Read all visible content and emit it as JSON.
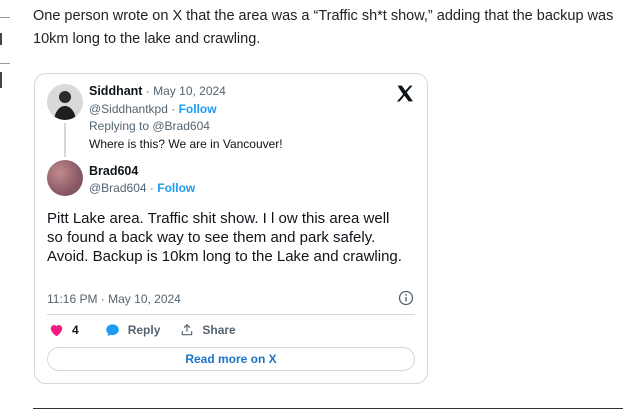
{
  "article": {
    "intro": "One person wrote on X that the area was a “Traffic sh*t show,” adding that the backup was 10km long to the lake and crawling."
  },
  "tweet": {
    "parent": {
      "name": "Siddhant",
      "date": "May 10, 2024",
      "handle": "@Siddhantkpd",
      "follow_label": "Follow",
      "replying_to": "Replying to @Brad604",
      "text": "Where is this? We are in Vancouver!"
    },
    "main": {
      "name": "Brad604",
      "handle": "@Brad604",
      "follow_label": "Follow",
      "text": "Pitt Lake area. Traffic shit show. I l ow this area well so found a back way to see them and park safely. Avoid. Backup is 10km long to the Lake and crawling.",
      "timestamp": "11:16 PM · May 10, 2024",
      "likes": "4",
      "reply_label": "Reply",
      "share_label": "Share",
      "read_more_label": "Read more on X"
    },
    "colors": {
      "follow": "#1d9bf0",
      "like": "#f91880",
      "reply": "#1d9bf0",
      "read_more": "#1d73c9"
    },
    "icons": [
      "x-logo-icon",
      "info-icon",
      "heart-icon",
      "reply-bubble-icon",
      "share-icon"
    ]
  }
}
